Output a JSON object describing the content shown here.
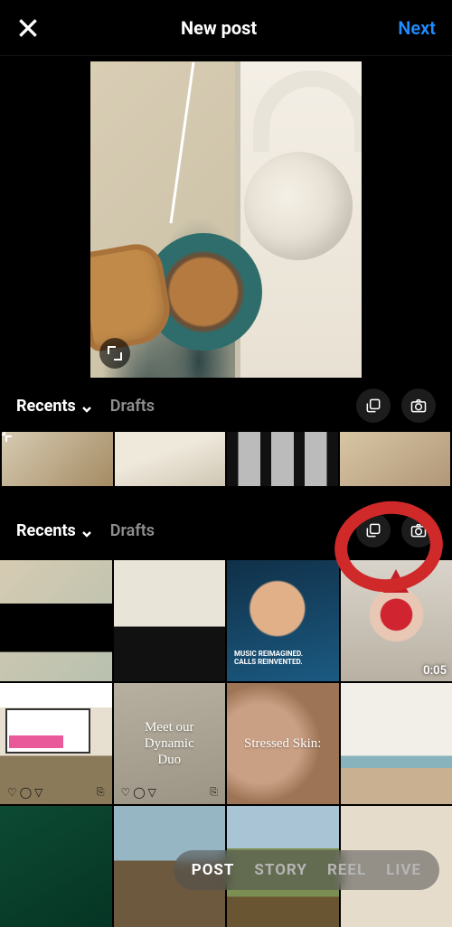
{
  "header": {
    "title": "New post",
    "next": "Next"
  },
  "preview_bar": {
    "folder_label": "Recents",
    "drafts_label": "Drafts"
  },
  "gallery_bar": {
    "folder_label": "Recents",
    "drafts_label": "Drafts"
  },
  "thumbnails_strip": [
    {
      "name": "coffee-headphones"
    },
    {
      "name": "headphones-flat"
    },
    {
      "name": "photo-strips"
    },
    {
      "name": "flatlay"
    }
  ],
  "grid": [
    {
      "name": "screenshot-newpost-1"
    },
    {
      "name": "screenshot-newpost-2"
    },
    {
      "name": "music-reimagined",
      "overlay": "MUSIC REIMAGINED.\nCALLS REINVENTED."
    },
    {
      "name": "gnome-video",
      "duration": "0:05"
    },
    {
      "name": "billboard-cracker"
    },
    {
      "name": "meet-our-dynamic-duo",
      "overlay": "Meet our\nDynamic\nDuo"
    },
    {
      "name": "stressed-skin",
      "overlay": "Stressed Skin:"
    },
    {
      "name": "yoga-room"
    },
    {
      "name": "green-products"
    },
    {
      "name": "man-outdoors"
    },
    {
      "name": "field"
    },
    {
      "name": "beige"
    }
  ],
  "modes": {
    "post": "POST",
    "story": "STORY",
    "reel": "REEL",
    "live": "LIVE"
  },
  "colors": {
    "accent_blue": "#1f8cff",
    "annotation_red": "#d02929"
  }
}
